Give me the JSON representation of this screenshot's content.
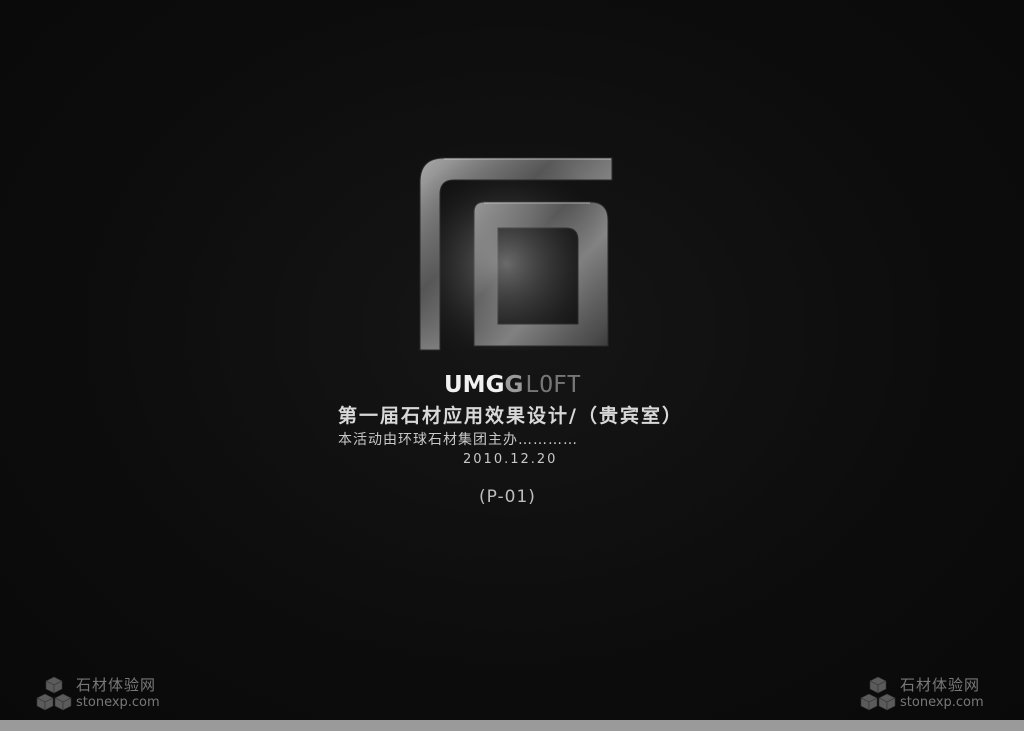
{
  "logo": {
    "brand_part1": "UMG",
    "brand_part2": "G",
    "brand_part3": "LOFT"
  },
  "title": "第一届石材应用效果设计/（贵宾室）",
  "subtitle": "本活动由环球石材集团主办…………",
  "date": "2010.12.20",
  "page_code": "(P-01)",
  "watermark": {
    "site_name": "石材体验网",
    "url": "stonexp.com"
  },
  "colors": {
    "background": "#0c0c0c",
    "text": "#d0d0d0",
    "bottom_bar": "#9a9a9a"
  }
}
